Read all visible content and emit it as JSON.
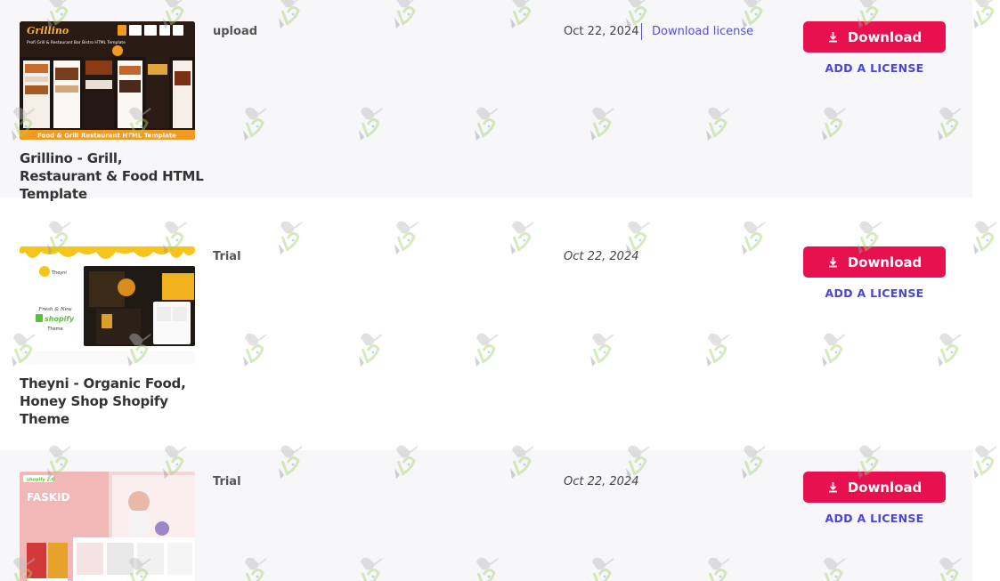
{
  "colors": {
    "accent_red": "#e8114f",
    "link_purple": "#5a4fcf",
    "license_blue": "#4b44d4",
    "row_shade": "#f7f7fa"
  },
  "items": [
    {
      "name": "Grillino - Grill, Restaurant & Food HTML Template",
      "type": "upload",
      "date": "Oct 22, 2024",
      "download_license_label": "Download license",
      "download_label": "Download",
      "add_license_label": "ADD A LICENSE",
      "thumb": {
        "brand": "Grillino",
        "subtitle": "Profi Grill & Restaurant Bar Bistro HTML Template",
        "footer": "Food & Grill Restaurant HTML Template"
      }
    },
    {
      "name": "Theyni - Organic Food, Honey Shop Shopify Theme",
      "type": "Trial",
      "date": "Oct 22, 2024",
      "download_label": "Download",
      "add_license_label": "ADD A LICENSE",
      "thumb": {
        "brand": "Theyni",
        "line1": "Fresh & New",
        "line2": "shopify",
        "line3": "Theme"
      }
    },
    {
      "name": "",
      "type": "Trial",
      "date": "Oct 22, 2024",
      "download_label": "Download",
      "add_license_label": "ADD A LICENSE",
      "thumb": {
        "badge": "shopify 2.0",
        "brand": "FASKID"
      }
    }
  ],
  "icons": {
    "download": "download-arrow-icon",
    "watermark": "watering-can-plant-icon"
  }
}
